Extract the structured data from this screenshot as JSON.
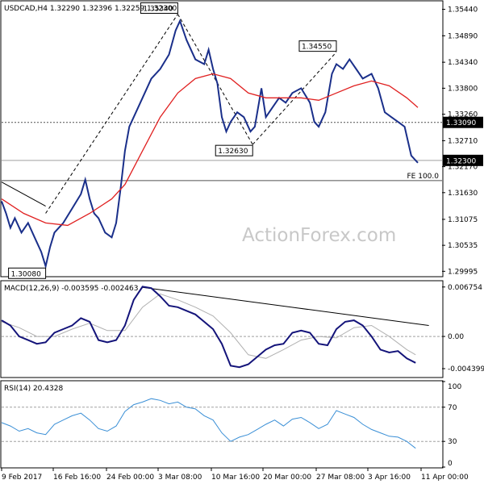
{
  "chart_data": {
    "type": "line",
    "instrument": "USDCAD",
    "timeframe": "H4",
    "ohlc_label": "USDCAD,H4  1.32290 1.32396 1.32259 1.32300",
    "watermark": "ActionForex.com",
    "x_tick_labels": [
      "9 Feb 2017",
      "16 Feb 16:00",
      "24 Feb 00:00",
      "3 Mar 08:00",
      "10 Mar 16:00",
      "20 Mar 00:00",
      "27 Mar 08:00",
      "3 Apr 16:00",
      "11 Apr 00:00"
    ],
    "main": {
      "ylim": [
        1.299,
        1.356
      ],
      "y_ticks": [
        "1.35440",
        "1.34890",
        "1.34340",
        "1.33800",
        "1.33260",
        "1.32710",
        "1.32170",
        "1.31630",
        "1.31075",
        "1.30535",
        "1.29995"
      ],
      "y_tick_values": [
        1.3544,
        1.3489,
        1.3434,
        1.338,
        1.3326,
        1.3271,
        1.3217,
        1.3163,
        1.31075,
        1.30535,
        1.29995
      ],
      "current_price": {
        "label": "1.32300",
        "value": 1.323
      },
      "level_line": {
        "label": "1.33090",
        "value": 1.3309
      },
      "fe_line": {
        "label": "FE 100.0",
        "value": 1.3188
      },
      "price_annotations": [
        {
          "label": "1.35340",
          "value": 1.3534,
          "t": 0.4
        },
        {
          "label": "1.34550",
          "value": 1.3455,
          "t": 0.76
        },
        {
          "label": "1.32630",
          "value": 1.3263,
          "t": 0.57
        },
        {
          "label": "1.30080",
          "value": 1.3008,
          "t": 0.1
        }
      ],
      "trend_lines": [
        {
          "from": {
            "t": 0.0,
            "value": 1.3185
          },
          "to": {
            "t": 0.1,
            "value": 1.3135
          }
        },
        {
          "from": {
            "t": 0.1,
            "value": 1.312
          },
          "to": {
            "t": 0.4,
            "value": 1.3534
          }
        },
        {
          "from": {
            "t": 0.4,
            "value": 1.3534
          },
          "to": {
            "t": 0.57,
            "value": 1.3263
          }
        },
        {
          "from": {
            "t": 0.57,
            "value": 1.3263
          },
          "to": {
            "t": 0.76,
            "value": 1.3455
          }
        }
      ],
      "price_series": [
        [
          0.0,
          1.3145
        ],
        [
          0.01,
          1.312
        ],
        [
          0.02,
          1.309
        ],
        [
          0.03,
          1.311
        ],
        [
          0.045,
          1.308
        ],
        [
          0.06,
          1.31
        ],
        [
          0.075,
          1.307
        ],
        [
          0.09,
          1.304
        ],
        [
          0.1,
          1.301
        ],
        [
          0.11,
          1.305
        ],
        [
          0.12,
          1.308
        ],
        [
          0.14,
          1.31
        ],
        [
          0.16,
          1.313
        ],
        [
          0.18,
          1.316
        ],
        [
          0.19,
          1.319
        ],
        [
          0.2,
          1.315
        ],
        [
          0.21,
          1.312
        ],
        [
          0.22,
          1.311
        ],
        [
          0.235,
          1.308
        ],
        [
          0.25,
          1.307
        ],
        [
          0.26,
          1.31
        ],
        [
          0.27,
          1.317
        ],
        [
          0.28,
          1.325
        ],
        [
          0.29,
          1.33
        ],
        [
          0.305,
          1.333
        ],
        [
          0.32,
          1.336
        ],
        [
          0.34,
          1.34
        ],
        [
          0.36,
          1.342
        ],
        [
          0.38,
          1.345
        ],
        [
          0.395,
          1.35
        ],
        [
          0.405,
          1.352
        ],
        [
          0.42,
          1.348
        ],
        [
          0.44,
          1.344
        ],
        [
          0.46,
          1.343
        ],
        [
          0.47,
          1.346
        ],
        [
          0.48,
          1.342
        ],
        [
          0.49,
          1.339
        ],
        [
          0.5,
          1.332
        ],
        [
          0.51,
          1.329
        ],
        [
          0.52,
          1.331
        ],
        [
          0.535,
          1.333
        ],
        [
          0.55,
          1.332
        ],
        [
          0.565,
          1.329
        ],
        [
          0.575,
          1.33
        ],
        [
          0.59,
          1.338
        ],
        [
          0.6,
          1.332
        ],
        [
          0.615,
          1.334
        ],
        [
          0.63,
          1.336
        ],
        [
          0.645,
          1.335
        ],
        [
          0.66,
          1.337
        ],
        [
          0.68,
          1.338
        ],
        [
          0.7,
          1.335
        ],
        [
          0.71,
          1.331
        ],
        [
          0.72,
          1.33
        ],
        [
          0.735,
          1.333
        ],
        [
          0.75,
          1.341
        ],
        [
          0.76,
          1.343
        ],
        [
          0.775,
          1.342
        ],
        [
          0.79,
          1.344
        ],
        [
          0.805,
          1.342
        ],
        [
          0.82,
          1.34
        ],
        [
          0.84,
          1.341
        ],
        [
          0.855,
          1.338
        ],
        [
          0.87,
          1.333
        ],
        [
          0.885,
          1.332
        ],
        [
          0.9,
          1.331
        ],
        [
          0.915,
          1.33
        ],
        [
          0.93,
          1.324
        ],
        [
          0.945,
          1.3225
        ]
      ],
      "ma_series": [
        [
          0.0,
          1.315
        ],
        [
          0.05,
          1.312
        ],
        [
          0.1,
          1.31
        ],
        [
          0.15,
          1.3095
        ],
        [
          0.2,
          1.312
        ],
        [
          0.25,
          1.315
        ],
        [
          0.28,
          1.318
        ],
        [
          0.32,
          1.325
        ],
        [
          0.36,
          1.332
        ],
        [
          0.4,
          1.337
        ],
        [
          0.44,
          1.34
        ],
        [
          0.48,
          1.341
        ],
        [
          0.52,
          1.34
        ],
        [
          0.56,
          1.337
        ],
        [
          0.6,
          1.336
        ],
        [
          0.64,
          1.336
        ],
        [
          0.68,
          1.336
        ],
        [
          0.72,
          1.3355
        ],
        [
          0.76,
          1.337
        ],
        [
          0.8,
          1.3385
        ],
        [
          0.84,
          1.3395
        ],
        [
          0.88,
          1.3385
        ],
        [
          0.92,
          1.336
        ],
        [
          0.945,
          1.334
        ]
      ]
    },
    "macd": {
      "label": "MACD(12,26,9) -0.003595 -0.002463",
      "ylim": [
        -0.0055,
        0.0075
      ],
      "y_ticks": [
        "0.006754",
        "0.00",
        "-0.004399"
      ],
      "y_tick_values": [
        0.006754,
        0.0,
        -0.004399
      ],
      "zero_line": 0.0,
      "trend_line": {
        "from": {
          "t": 0.32,
          "value": 0.0067
        },
        "to": {
          "t": 0.97,
          "value": 0.0015
        }
      },
      "macd_series": [
        [
          0.0,
          0.0022
        ],
        [
          0.02,
          0.0015
        ],
        [
          0.04,
          0.0
        ],
        [
          0.06,
          -0.0005
        ],
        [
          0.08,
          -0.001
        ],
        [
          0.1,
          -0.0008
        ],
        [
          0.12,
          0.0005
        ],
        [
          0.14,
          0.001
        ],
        [
          0.16,
          0.0015
        ],
        [
          0.18,
          0.0025
        ],
        [
          0.2,
          0.002
        ],
        [
          0.22,
          -0.0005
        ],
        [
          0.24,
          -0.0008
        ],
        [
          0.26,
          -0.0005
        ],
        [
          0.28,
          0.0015
        ],
        [
          0.3,
          0.005
        ],
        [
          0.32,
          0.0068
        ],
        [
          0.34,
          0.0066
        ],
        [
          0.36,
          0.0055
        ],
        [
          0.38,
          0.0042
        ],
        [
          0.4,
          0.004
        ],
        [
          0.42,
          0.0035
        ],
        [
          0.44,
          0.003
        ],
        [
          0.46,
          0.002
        ],
        [
          0.48,
          0.001
        ],
        [
          0.5,
          -0.001
        ],
        [
          0.52,
          -0.004
        ],
        [
          0.54,
          -0.0042
        ],
        [
          0.56,
          -0.0038
        ],
        [
          0.58,
          -0.0028
        ],
        [
          0.6,
          -0.0018
        ],
        [
          0.62,
          -0.0012
        ],
        [
          0.64,
          -0.001
        ],
        [
          0.66,
          0.0005
        ],
        [
          0.68,
          0.0008
        ],
        [
          0.7,
          0.0005
        ],
        [
          0.72,
          -0.001
        ],
        [
          0.74,
          -0.0012
        ],
        [
          0.76,
          0.001
        ],
        [
          0.78,
          0.002
        ],
        [
          0.8,
          0.0022
        ],
        [
          0.82,
          0.0015
        ],
        [
          0.84,
          0.0
        ],
        [
          0.86,
          -0.0018
        ],
        [
          0.88,
          -0.0022
        ],
        [
          0.9,
          -0.002
        ],
        [
          0.92,
          -0.003
        ],
        [
          0.94,
          -0.0036
        ]
      ],
      "signal_series": [
        [
          0.0,
          0.002
        ],
        [
          0.04,
          0.0012
        ],
        [
          0.08,
          0.0
        ],
        [
          0.12,
          0.0
        ],
        [
          0.16,
          0.001
        ],
        [
          0.2,
          0.0018
        ],
        [
          0.24,
          0.0008
        ],
        [
          0.28,
          0.0008
        ],
        [
          0.32,
          0.004
        ],
        [
          0.36,
          0.0058
        ],
        [
          0.4,
          0.005
        ],
        [
          0.44,
          0.004
        ],
        [
          0.48,
          0.0028
        ],
        [
          0.52,
          0.0005
        ],
        [
          0.56,
          -0.0025
        ],
        [
          0.6,
          -0.003
        ],
        [
          0.64,
          -0.0018
        ],
        [
          0.68,
          -0.0005
        ],
        [
          0.72,
          0.0
        ],
        [
          0.76,
          -0.0002
        ],
        [
          0.8,
          0.0012
        ],
        [
          0.84,
          0.0015
        ],
        [
          0.88,
          0.0
        ],
        [
          0.92,
          -0.0018
        ],
        [
          0.94,
          -0.0025
        ]
      ]
    },
    "rsi": {
      "label": "RSI(14) 20.4328",
      "ylim": [
        0,
        100
      ],
      "y_ticks": [
        "100",
        "70",
        "30",
        "0"
      ],
      "y_tick_values": [
        100,
        70,
        30,
        0
      ],
      "levels": [
        70,
        30
      ],
      "rsi_series": [
        [
          0.0,
          52
        ],
        [
          0.02,
          48
        ],
        [
          0.04,
          42
        ],
        [
          0.06,
          45
        ],
        [
          0.08,
          40
        ],
        [
          0.1,
          38
        ],
        [
          0.12,
          50
        ],
        [
          0.14,
          55
        ],
        [
          0.16,
          60
        ],
        [
          0.18,
          63
        ],
        [
          0.2,
          55
        ],
        [
          0.22,
          45
        ],
        [
          0.24,
          42
        ],
        [
          0.26,
          48
        ],
        [
          0.28,
          65
        ],
        [
          0.3,
          73
        ],
        [
          0.32,
          76
        ],
        [
          0.34,
          80
        ],
        [
          0.36,
          78
        ],
        [
          0.38,
          74
        ],
        [
          0.4,
          76
        ],
        [
          0.42,
          70
        ],
        [
          0.44,
          68
        ],
        [
          0.46,
          60
        ],
        [
          0.48,
          55
        ],
        [
          0.5,
          40
        ],
        [
          0.52,
          30
        ],
        [
          0.54,
          35
        ],
        [
          0.56,
          38
        ],
        [
          0.58,
          44
        ],
        [
          0.6,
          50
        ],
        [
          0.62,
          55
        ],
        [
          0.64,
          48
        ],
        [
          0.66,
          56
        ],
        [
          0.68,
          58
        ],
        [
          0.7,
          52
        ],
        [
          0.72,
          45
        ],
        [
          0.74,
          50
        ],
        [
          0.76,
          66
        ],
        [
          0.78,
          62
        ],
        [
          0.8,
          58
        ],
        [
          0.82,
          50
        ],
        [
          0.84,
          44
        ],
        [
          0.86,
          40
        ],
        [
          0.88,
          36
        ],
        [
          0.9,
          35
        ],
        [
          0.92,
          30
        ],
        [
          0.94,
          22
        ]
      ]
    }
  }
}
